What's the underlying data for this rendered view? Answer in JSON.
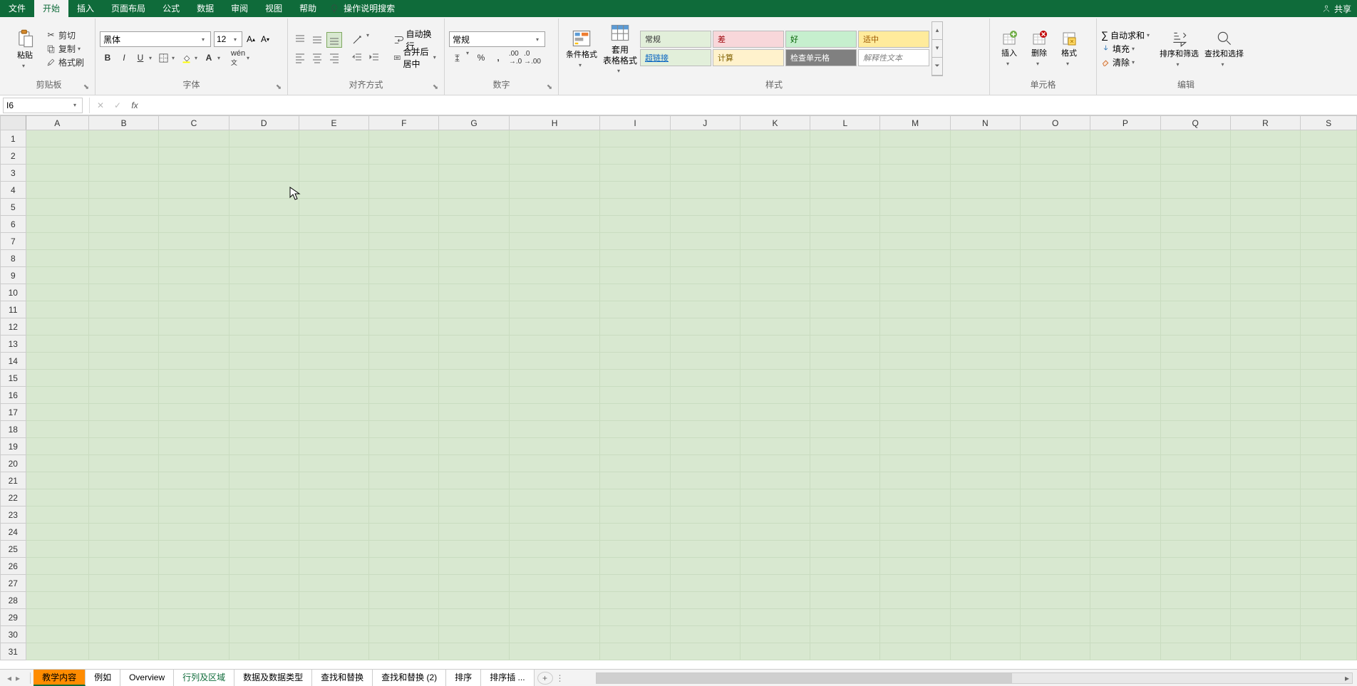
{
  "menu": {
    "file": "文件",
    "home": "开始",
    "insert": "插入",
    "layout": "页面布局",
    "formulas": "公式",
    "data": "数据",
    "review": "审阅",
    "view": "视图",
    "help": "帮助",
    "tell": "操作说明搜索",
    "share": "共享"
  },
  "ribbon": {
    "clipboard": {
      "paste": "粘贴",
      "cut": "剪切",
      "copy": "复制",
      "painter": "格式刷",
      "label": "剪贴板"
    },
    "font": {
      "name": "黑体",
      "size": "12",
      "label": "字体"
    },
    "align": {
      "wrap": "自动换行",
      "merge": "合并后居中",
      "label": "对齐方式"
    },
    "number": {
      "format": "常规",
      "label": "数字"
    },
    "cond": {
      "label": "条件格式"
    },
    "table": {
      "label1": "套用",
      "label2": "表格格式"
    },
    "styles": {
      "normal": "常规",
      "bad": "差",
      "good": "好",
      "neutral": "适中",
      "link": "超链接",
      "calc": "计算",
      "check": "检查单元格",
      "note": "解释性文本",
      "label": "样式"
    },
    "cells": {
      "insert": "插入",
      "delete": "删除",
      "format": "格式",
      "label": "单元格"
    },
    "edit": {
      "sum": "自动求和",
      "fill": "填充",
      "clear": "清除",
      "sort": "排序和筛选",
      "find": "查找和选择",
      "label": "编辑"
    }
  },
  "formula_bar": {
    "name": "I6",
    "value": ""
  },
  "columns": [
    "A",
    "B",
    "C",
    "D",
    "E",
    "F",
    "G",
    "H",
    "I",
    "J",
    "K",
    "L",
    "M",
    "N",
    "O",
    "P",
    "Q",
    "R",
    "S"
  ],
  "rows": [
    "1",
    "2",
    "3",
    "4",
    "5",
    "6",
    "7",
    "8",
    "9",
    "10",
    "11",
    "12",
    "13",
    "14",
    "15",
    "16",
    "17",
    "18",
    "19",
    "20",
    "21",
    "22",
    "23",
    "24",
    "25",
    "26",
    "27",
    "28",
    "29",
    "30",
    "31"
  ],
  "tabs": [
    "教学内容",
    "例如",
    "Overview",
    "行列及区域",
    "数据及数据类型",
    "查找和替换",
    "查找和替换 (2)",
    "排序",
    "排序插 ..."
  ],
  "active_tab": 0,
  "green_tab": 3
}
